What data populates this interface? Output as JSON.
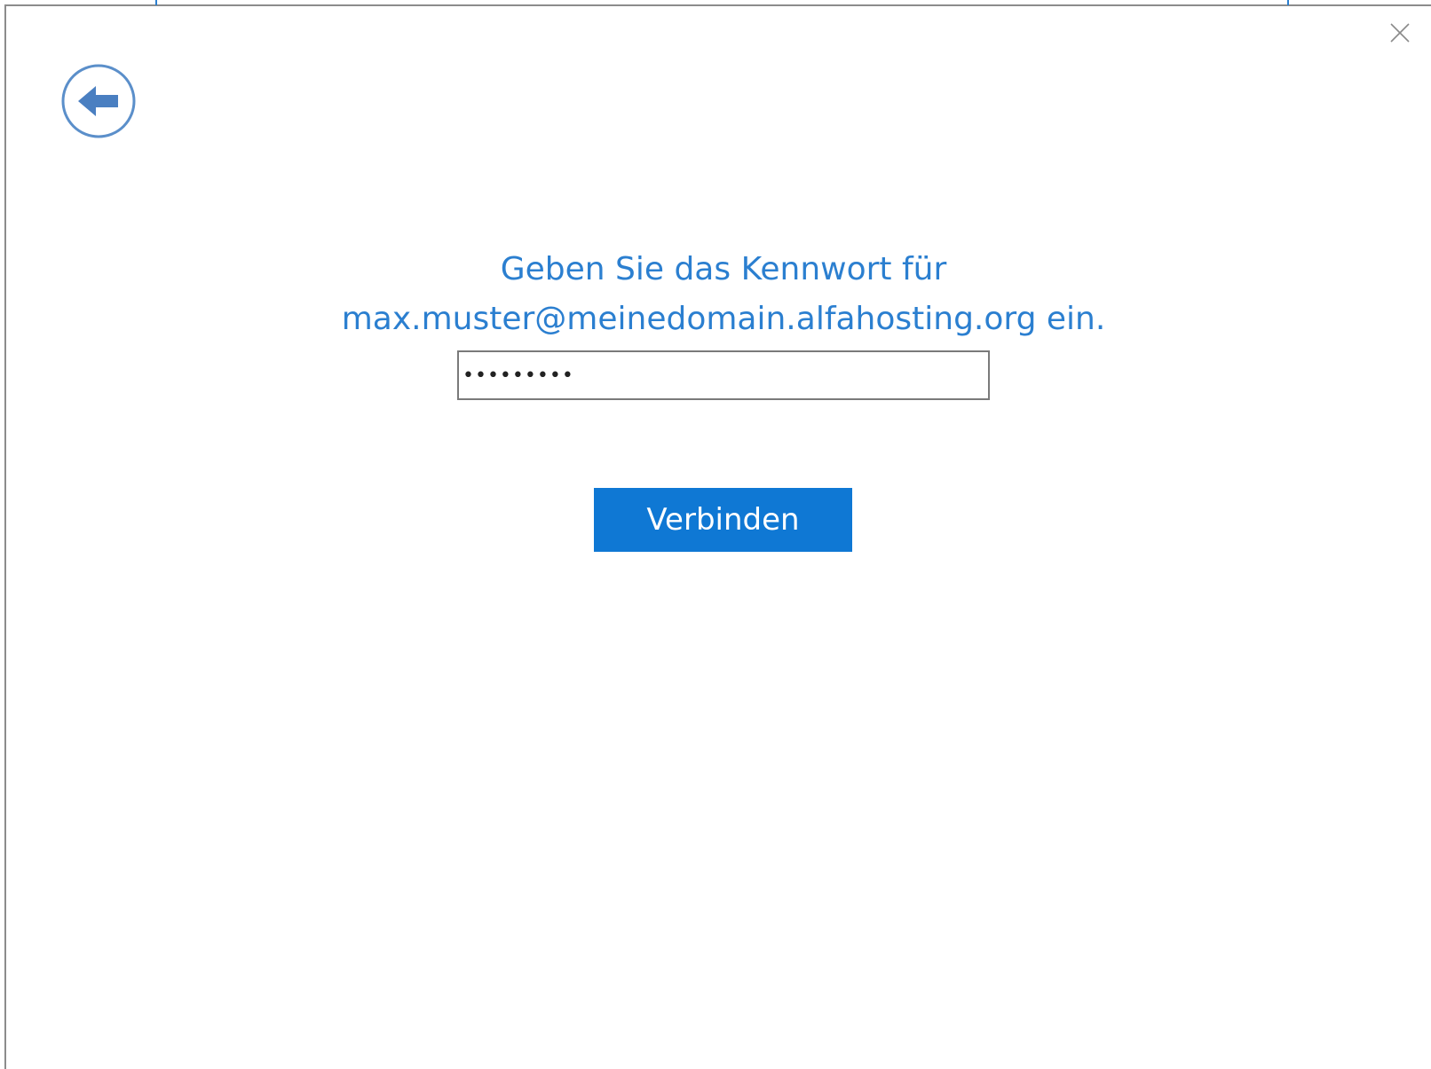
{
  "dialog": {
    "close_icon": "close-icon",
    "back_icon": "back-arrow-icon",
    "prompt_line1": "Geben Sie das Kennwort für",
    "prompt_line2": "max.muster@meinedomain.alfahosting.org ein.",
    "password_value": "•••••••••",
    "connect_label": "Verbinden"
  },
  "colors": {
    "accent": "#2b7fd0",
    "button": "#0f78d4",
    "border": "#7a7a7a"
  }
}
